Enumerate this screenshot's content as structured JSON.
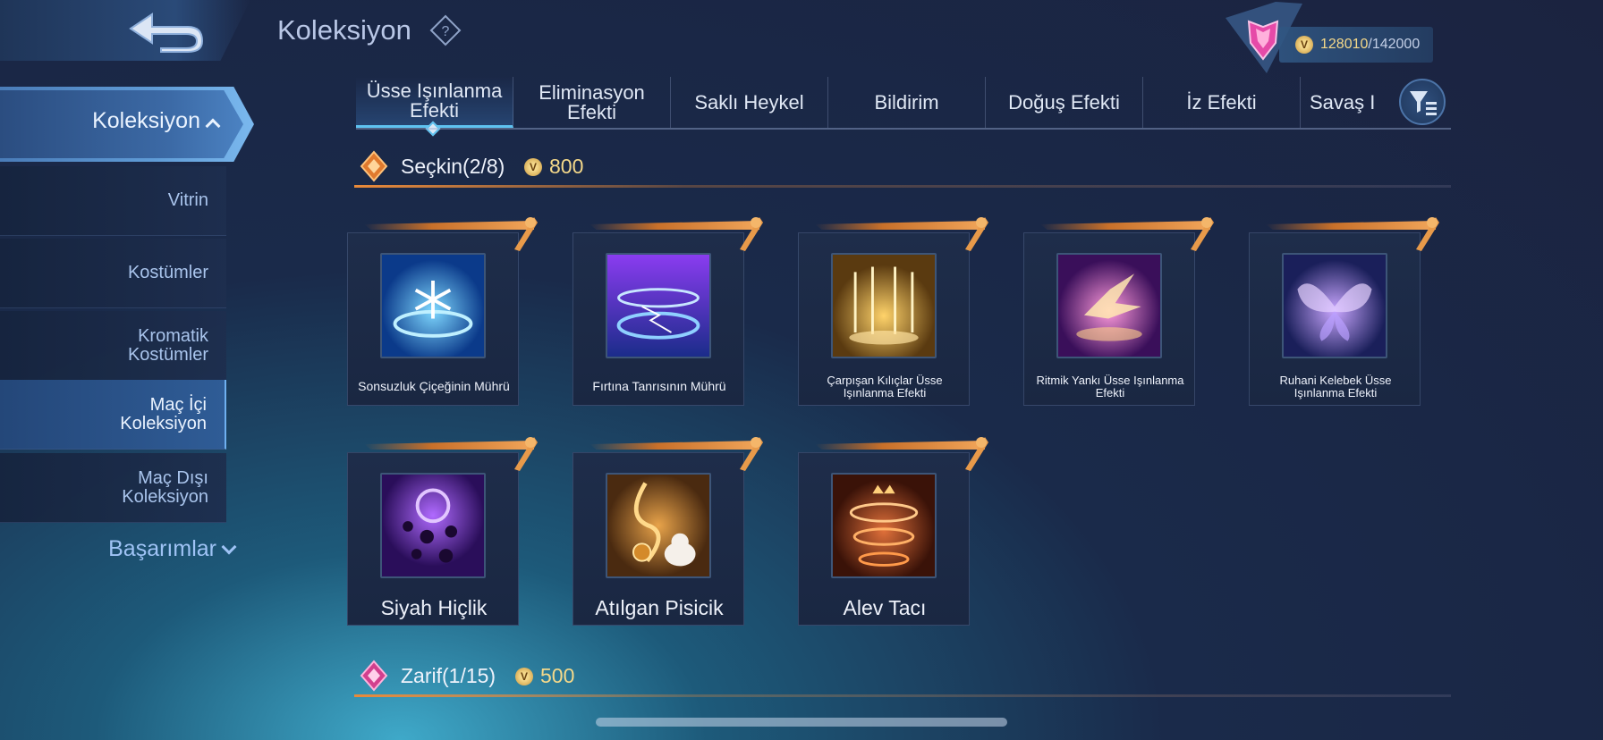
{
  "header": {
    "title": "Koleksiyon",
    "currency_value": "128010",
    "currency_max": "/142000"
  },
  "sidebar": {
    "main_label": "Koleksiyon",
    "items": [
      {
        "label": "Vitrin"
      },
      {
        "label": "Kostümler"
      },
      {
        "label": "Kromatik\nKostümler"
      },
      {
        "label": "Maç İçi\nKoleksiyon"
      },
      {
        "label": "Maç Dışı\nKoleksiyon"
      }
    ],
    "active_item": 3,
    "extra_label": "Başarımlar"
  },
  "tabs": [
    {
      "label": "Üsse Işınlanma\nEfekti",
      "active": true
    },
    {
      "label": "Eliminasyon\nEfekti"
    },
    {
      "label": "Saklı Heykel"
    },
    {
      "label": "Bildirim"
    },
    {
      "label": "Doğuş Efekti"
    },
    {
      "label": "İz Efekti"
    },
    {
      "label": "Savaş I"
    }
  ],
  "sections": {
    "elite": {
      "label": "Seçkin(2/8)",
      "price": "800"
    },
    "graceful": {
      "label": "Zarif(1/15)",
      "price": "500"
    }
  },
  "items": [
    {
      "name": "Sonsuzluk Çiçeğinin Mührü"
    },
    {
      "name": "Fırtına Tanrısının Mührü"
    },
    {
      "name": "Çarpışan Kılıçlar Üsse Işınlanma Efekti"
    },
    {
      "name": "Ritmik Yankı Üsse Işınlanma Efekti"
    },
    {
      "name": "Ruhani Kelebek Üsse Işınlanma Efekti"
    },
    {
      "name": "Siyah Hiçlik"
    },
    {
      "name": "Atılgan Pisicik"
    },
    {
      "name": "Alev Tacı"
    }
  ],
  "colors": {
    "accent": "#5ec2f0",
    "gold": "#f5d98a",
    "frame": "#e98a3a"
  },
  "icons": [
    "back-arrow-icon",
    "help-icon",
    "rank-badge-icon",
    "coin-icon",
    "filter-icon",
    "chevron-up-icon",
    "chevron-down-icon"
  ]
}
